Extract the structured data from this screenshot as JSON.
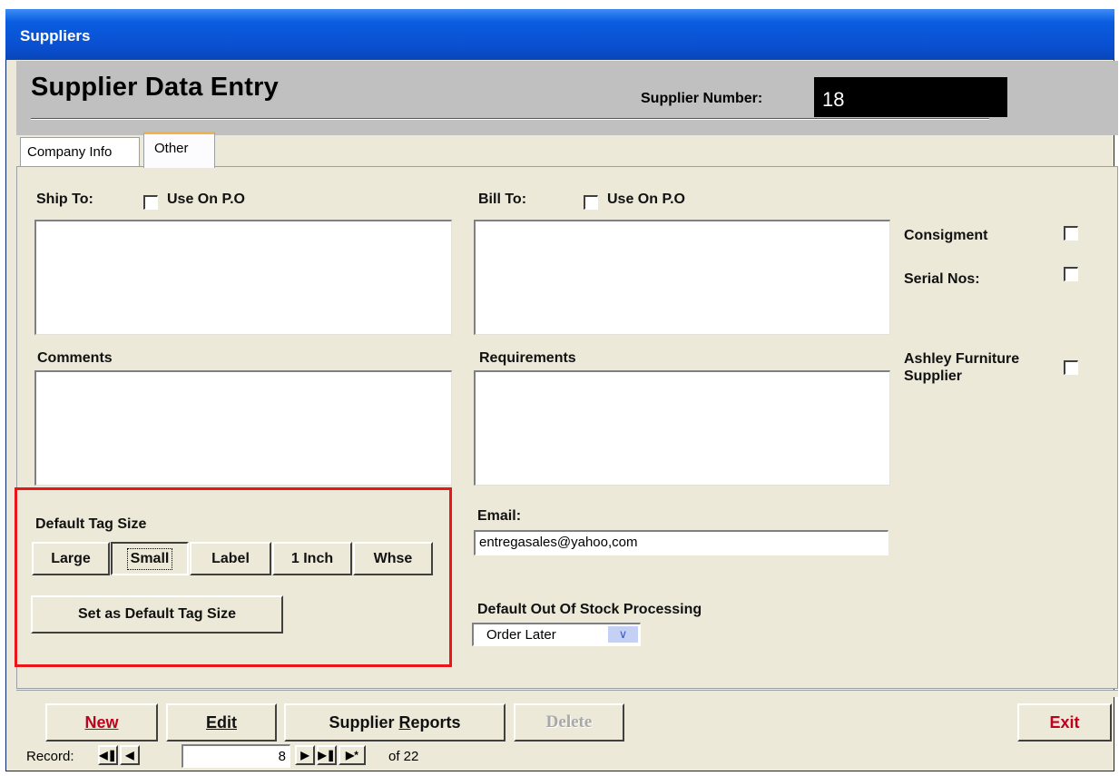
{
  "window": {
    "title": "Suppliers"
  },
  "header": {
    "form_title": "Supplier Data Entry",
    "supplier_number_label": "Supplier Number:",
    "supplier_number": "18"
  },
  "tabs": [
    {
      "label": "Company Info",
      "active": false
    },
    {
      "label": "Other",
      "active": true
    }
  ],
  "ship_to": {
    "label": "Ship To:",
    "use_on_po_label": "Use On P.O",
    "value": ""
  },
  "bill_to": {
    "label": "Bill To:",
    "use_on_po_label": "Use On P.O",
    "value": ""
  },
  "consignment_label": "Consigment",
  "serial_nos_label": "Serial Nos:",
  "ashley_label_line1": "Ashley Furniture",
  "ashley_label_line2": "Supplier",
  "comments": {
    "label": "Comments",
    "value": ""
  },
  "requirements": {
    "label": "Requirements",
    "value": ""
  },
  "tag_size": {
    "label": "Default Tag Size",
    "options": [
      "Large",
      "Small",
      "Label",
      "1 Inch",
      "Whse"
    ],
    "selected": "Small",
    "set_default_label": "Set as Default Tag Size"
  },
  "email": {
    "label": "Email:",
    "value": "entregasales@yahoo,com"
  },
  "out_of_stock": {
    "label": "Default Out Of Stock Processing",
    "selected": "Order Later"
  },
  "toolbar": {
    "new_label": "New",
    "edit_label": "Edit",
    "reports_label_prefix": "Supplier ",
    "reports_label_key": "R",
    "reports_label_rest": "eports",
    "delete_label": "Delete",
    "exit_label": "Exit"
  },
  "record_nav": {
    "label": "Record:",
    "current": "8",
    "of_text": "of 22"
  },
  "colors": {
    "titlebar": "#0a4fd0",
    "accent_red": "#e8151b",
    "tab_highlight": "#f2b24a"
  }
}
